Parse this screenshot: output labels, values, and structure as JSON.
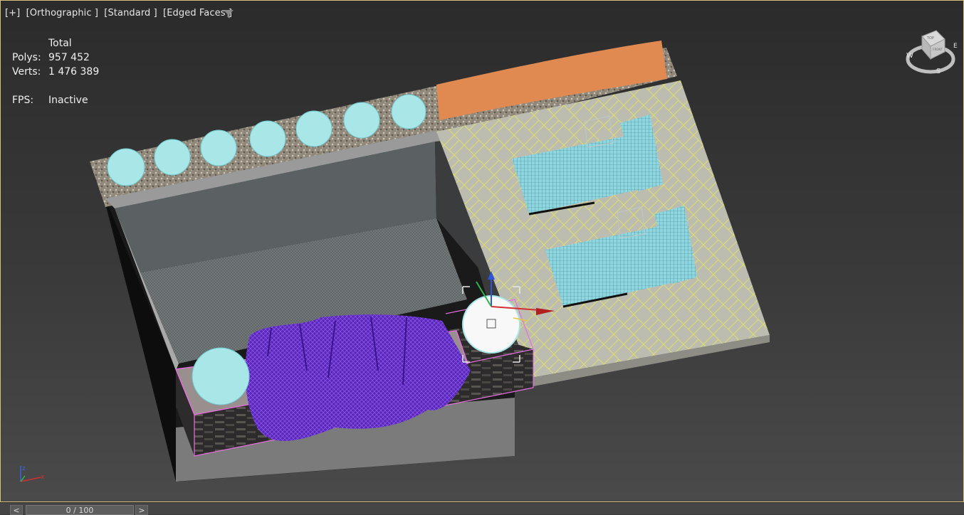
{
  "viewport": {
    "labels": [
      "[+]",
      "[Orthographic ]",
      "[Standard ]",
      "[Edged Faces ]"
    ],
    "filter_icon": "filter-icon"
  },
  "stats": {
    "header": "Total",
    "polys_label": "Polys:",
    "polys_value": "957 452",
    "verts_label": "Verts:",
    "verts_value": "1 476 389",
    "fps_label": "FPS:",
    "fps_value": "Inactive"
  },
  "viewcube": {
    "top_face": "TOP",
    "front_face": "FRONT",
    "compass": {
      "west": "W",
      "east": "E",
      "south": "S"
    }
  },
  "axis_tripod": {
    "z": "z",
    "x": "x",
    "y": "y"
  },
  "timeline": {
    "prev_label": "<",
    "next_label": ">",
    "frame_text": "0 / 100"
  },
  "colors": {
    "viewport_border": "#d7c07a",
    "flowers_orange": "#e08a52",
    "shrub_cyan": "#a8e6e8",
    "lavender_purple": "#6a2fc4",
    "selection_pink": "#e86ee0",
    "wire_yellow": "#e6e36a"
  }
}
